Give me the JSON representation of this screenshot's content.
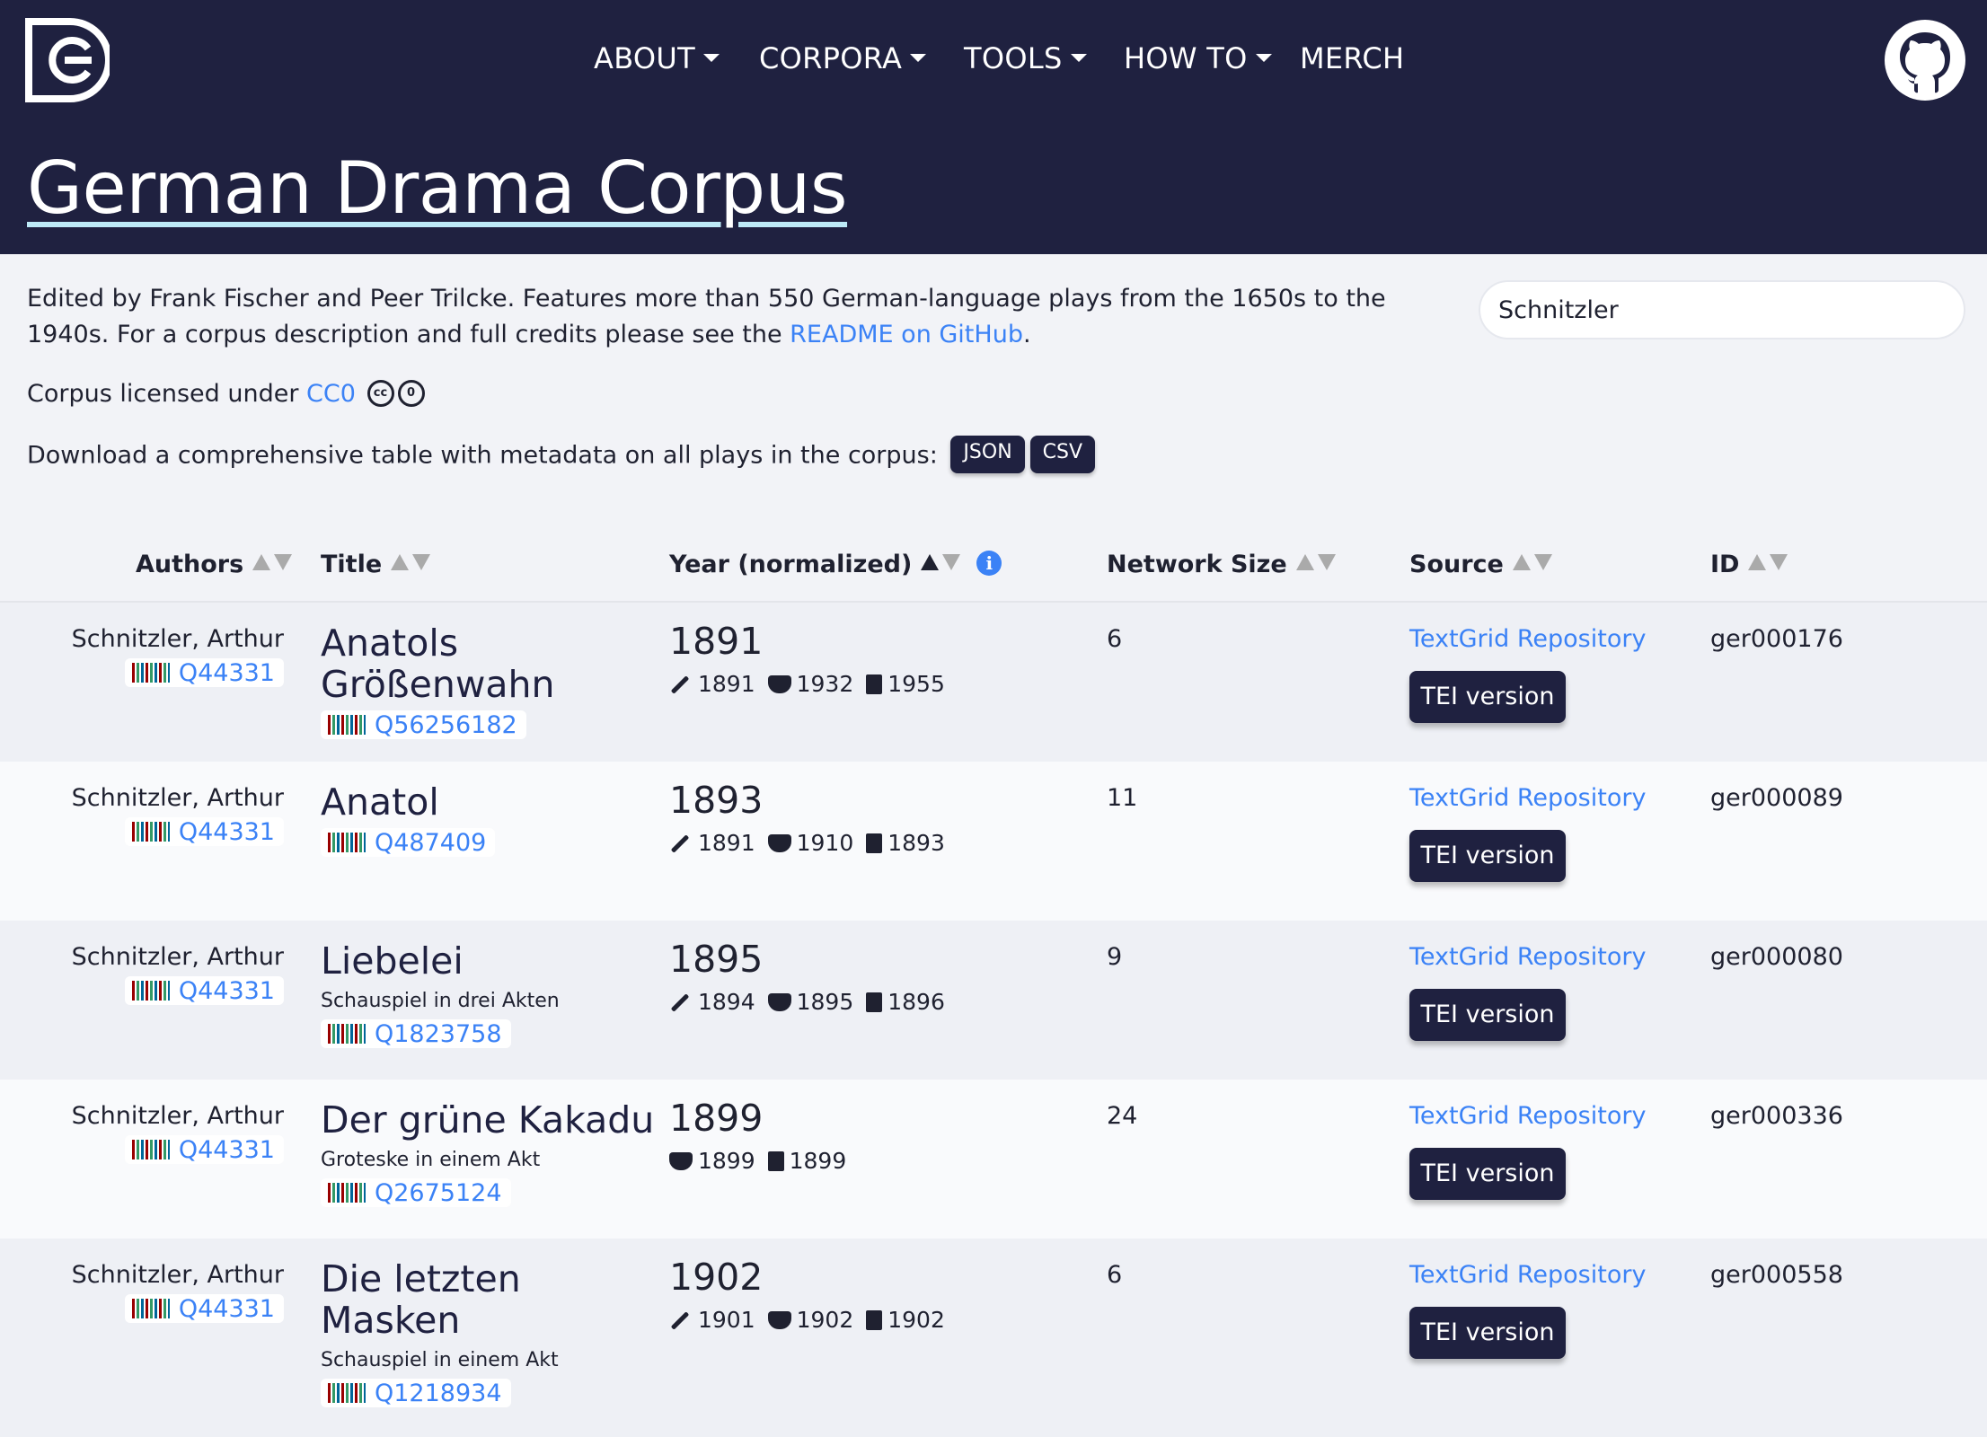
{
  "header": {
    "logo_icon": "dracor-logo-icon",
    "nav": [
      {
        "label": "ABOUT",
        "dropdown": true
      },
      {
        "label": "CORPORA",
        "dropdown": true
      },
      {
        "label": "TOOLS",
        "dropdown": true
      },
      {
        "label": "HOW TO",
        "dropdown": true
      },
      {
        "label": "MERCH",
        "dropdown": false
      }
    ],
    "github_icon": "github-icon",
    "corpus_title": "German Drama Corpus",
    "bg_color": "#1f2140"
  },
  "intro": {
    "desc_prefix": "Edited by Frank Fischer and Peer Trilcke. Features more than 550 German-language plays from the 1650s to the 1940s. For a corpus description and full credits please see the ",
    "desc_link": "README on GitHub",
    "desc_suffix": ".",
    "license_prefix": "Corpus licensed under ",
    "license_link": "CC0",
    "license_icon_cc": "cc",
    "license_icon_zero": "0",
    "download_text": "Download a comprehensive table with metadata on all plays in the corpus:",
    "download_json": "JSON",
    "download_csv": "CSV"
  },
  "search": {
    "value": "Schnitzler"
  },
  "table": {
    "headers": {
      "authors": "Authors",
      "title": "Title",
      "year": "Year (normalized)",
      "network": "Network Size",
      "source": "Source",
      "id": "ID"
    },
    "sorted_column": "year",
    "sort_direction": "ascending",
    "rows": [
      {
        "author": "Schnitzler, Arthur",
        "author_wd": "Q44331",
        "title": "Anatols Größenwahn",
        "subtitle": "",
        "title_wd": "Q56256182",
        "year": "1891",
        "written": "1891",
        "premiered": "1932",
        "printed": "1955",
        "network_size": "6",
        "source": "TextGrid Repository",
        "tei": "TEI version",
        "id": "ger000176"
      },
      {
        "author": "Schnitzler, Arthur",
        "author_wd": "Q44331",
        "title": "Anatol",
        "subtitle": "",
        "title_wd": "Q487409",
        "year": "1893",
        "written": "1891",
        "premiered": "1910",
        "printed": "1893",
        "network_size": "11",
        "source": "TextGrid Repository",
        "tei": "TEI version",
        "id": "ger000089"
      },
      {
        "author": "Schnitzler, Arthur",
        "author_wd": "Q44331",
        "title": "Liebelei",
        "subtitle": "Schauspiel in drei Akten",
        "title_wd": "Q1823758",
        "year": "1895",
        "written": "1894",
        "premiered": "1895",
        "printed": "1896",
        "network_size": "9",
        "source": "TextGrid Repository",
        "tei": "TEI version",
        "id": "ger000080"
      },
      {
        "author": "Schnitzler, Arthur",
        "author_wd": "Q44331",
        "title": "Der grüne Kakadu",
        "subtitle": "Groteske in einem Akt",
        "title_wd": "Q2675124",
        "year": "1899",
        "written": "",
        "premiered": "1899",
        "printed": "1899",
        "network_size": "24",
        "source": "TextGrid Repository",
        "tei": "TEI version",
        "id": "ger000336"
      },
      {
        "author": "Schnitzler, Arthur",
        "author_wd": "Q44331",
        "title": "Die letzten Masken",
        "subtitle": "Schauspiel in einem Akt",
        "title_wd": "Q1218934",
        "year": "1902",
        "written": "1901",
        "premiered": "1902",
        "printed": "1902",
        "network_size": "6",
        "source": "TextGrid Repository",
        "tei": "TEI version",
        "id": "ger000558"
      }
    ]
  }
}
